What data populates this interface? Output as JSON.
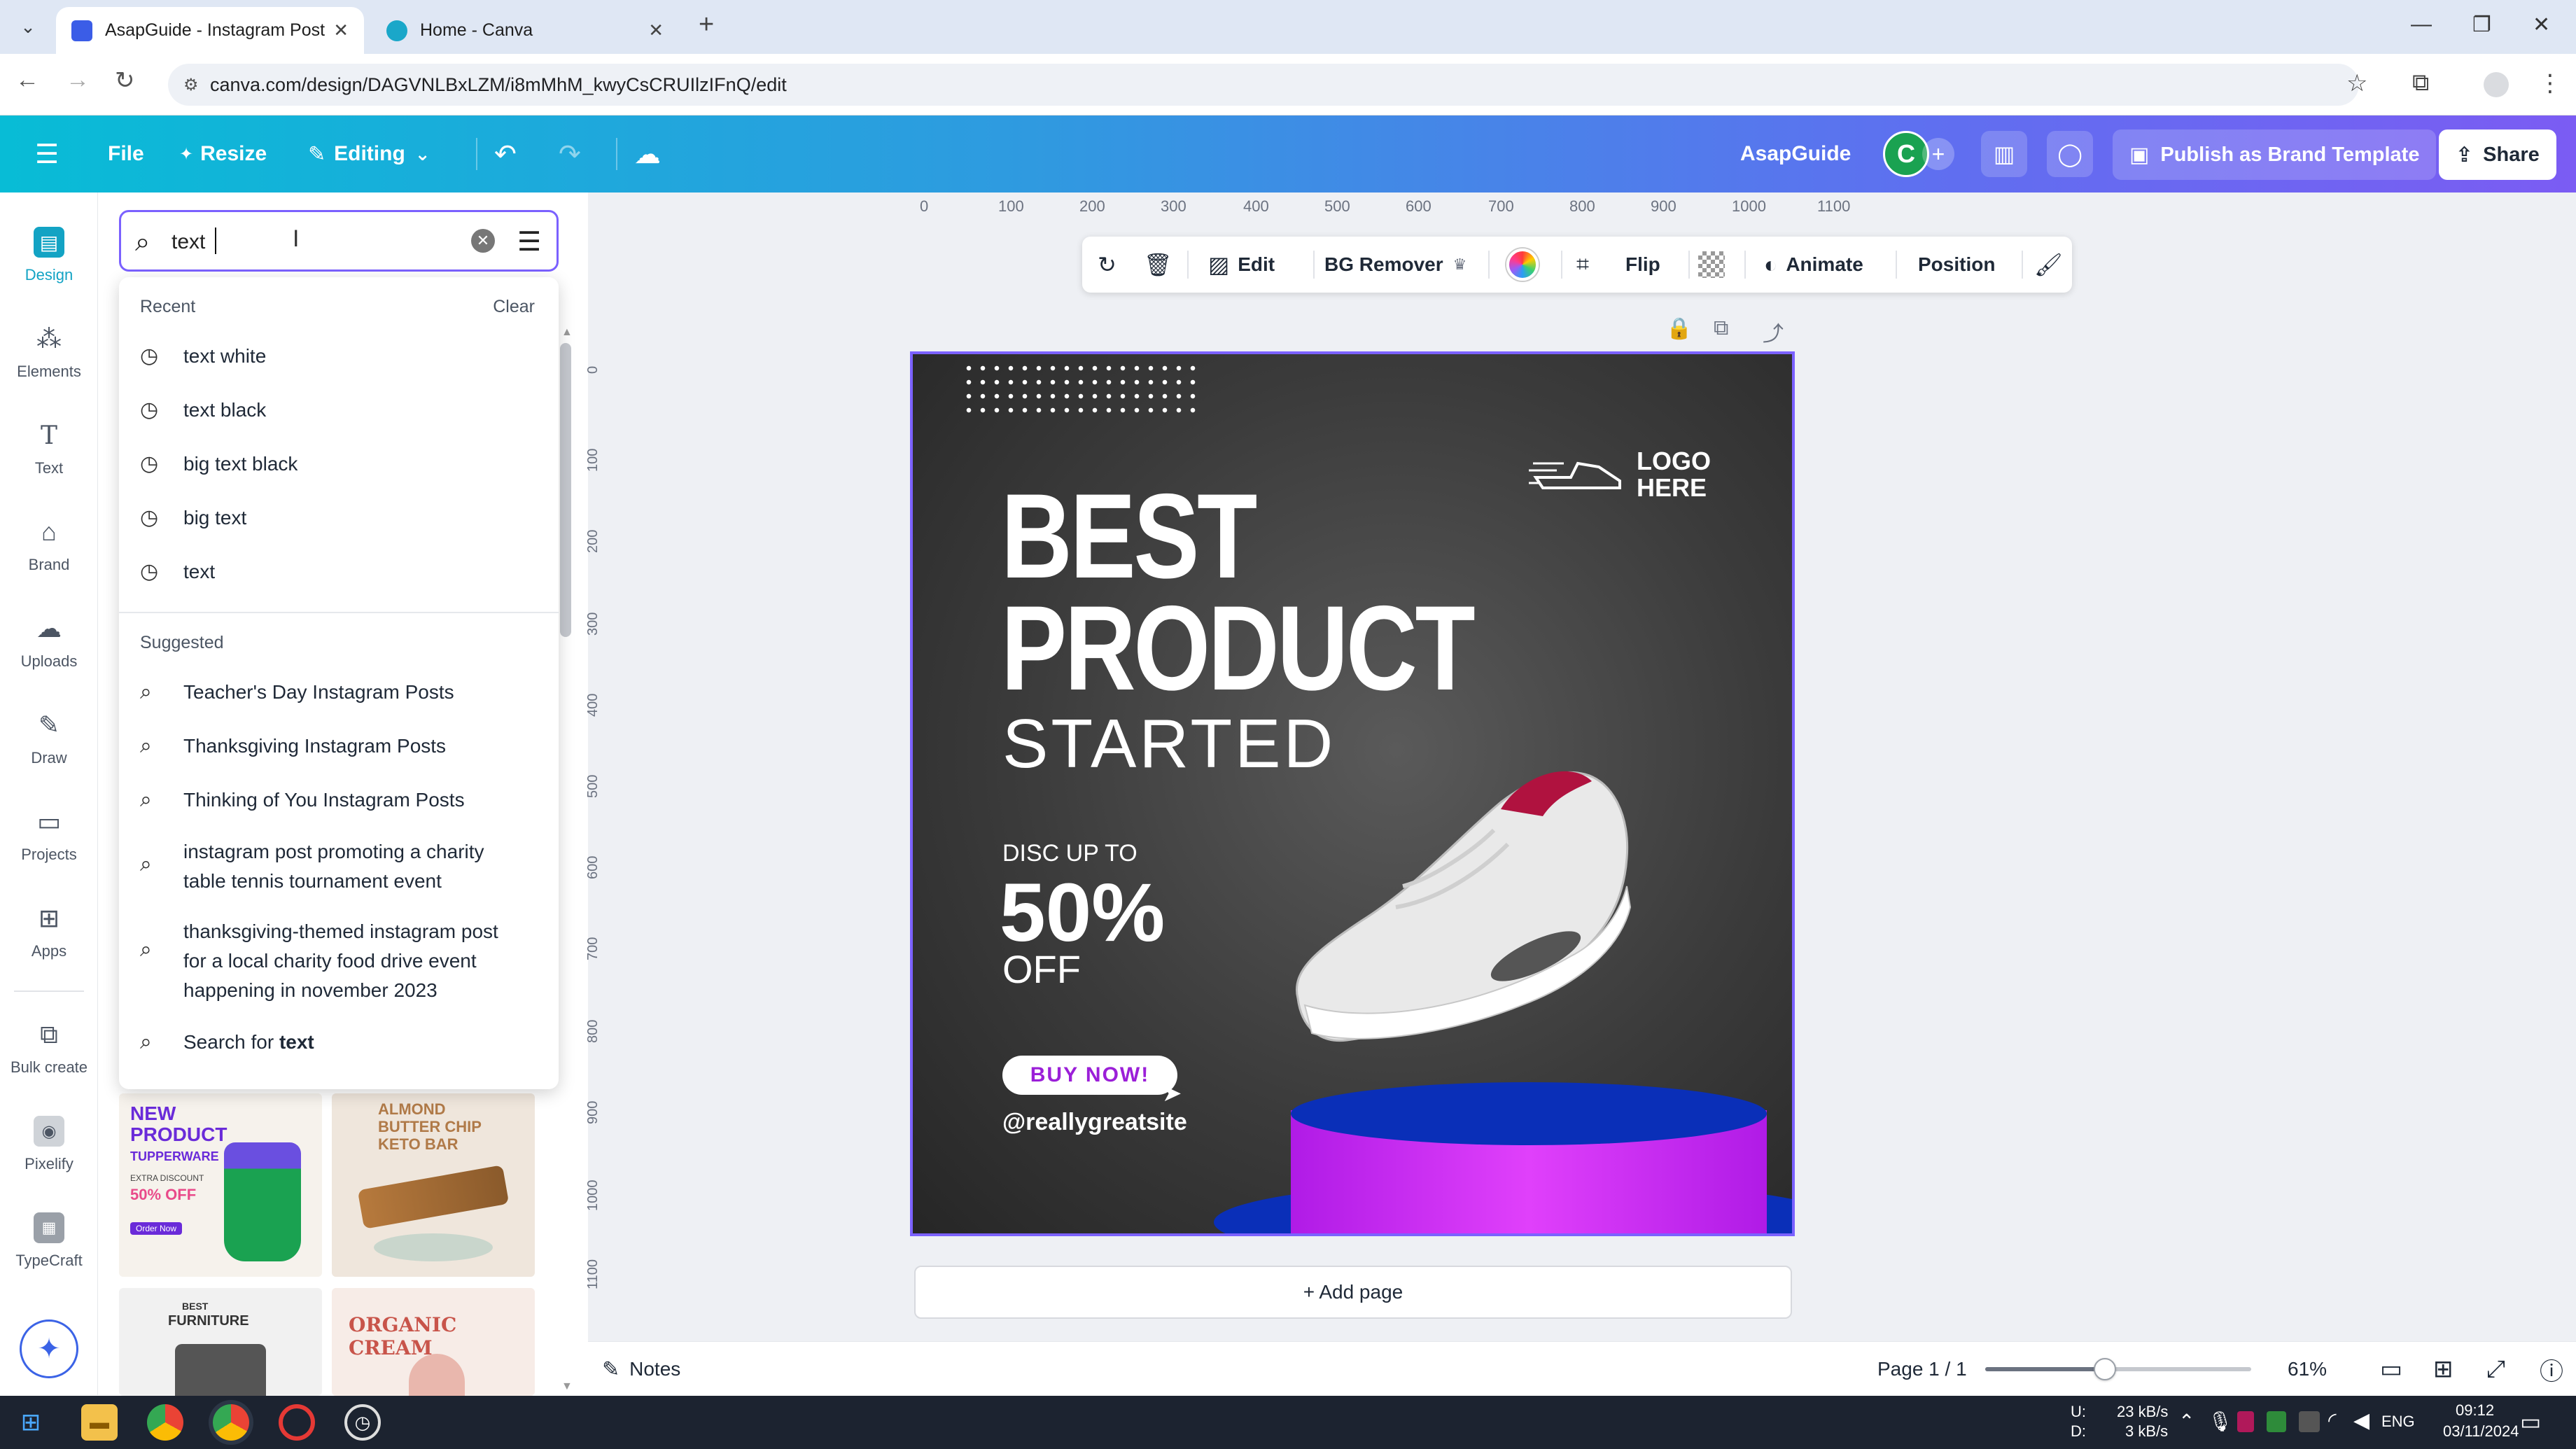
{
  "browser": {
    "tabs": [
      {
        "title": "AsapGuide - Instagram Post",
        "active": true,
        "favicon_color": "#3b5de7"
      },
      {
        "title": "Home - Canva",
        "active": false,
        "favicon_color": "#1aa7c9"
      }
    ],
    "url": "canva.com/design/DAGVNLBxLZM/i8mMhM_kwyCsCRUIlzIFnQ/edit"
  },
  "header": {
    "file": "File",
    "resize": "Resize",
    "editing": "Editing",
    "doc_name": "AsapGuide",
    "avatar_initial": "C",
    "publish": "Publish as Brand Template",
    "share": "Share"
  },
  "rail": {
    "items": [
      {
        "label": "Design",
        "icon": "design-icon"
      },
      {
        "label": "Elements",
        "icon": "elements-icon"
      },
      {
        "label": "Text",
        "icon": "text-icon"
      },
      {
        "label": "Brand",
        "icon": "brand-icon"
      },
      {
        "label": "Uploads",
        "icon": "uploads-icon"
      },
      {
        "label": "Draw",
        "icon": "draw-icon"
      },
      {
        "label": "Projects",
        "icon": "projects-icon"
      },
      {
        "label": "Apps",
        "icon": "apps-icon"
      },
      {
        "label": "Bulk create",
        "icon": "bulk-create-icon"
      },
      {
        "label": "Pixelify",
        "icon": "pixelify-icon"
      },
      {
        "label": "TypeCraft",
        "icon": "typecraft-icon"
      }
    ]
  },
  "search": {
    "value": "text",
    "recent_heading": "Recent",
    "clear": "Clear",
    "recent": [
      "text white",
      "text black",
      "big text black",
      "big text",
      "text"
    ],
    "suggested_heading": "Suggested",
    "suggested": [
      "Teacher's Day Instagram Posts",
      "Thanksgiving Instagram Posts",
      "Thinking of You Instagram Posts",
      "instagram post promoting a charity table tennis tournament event",
      "thanksgiving-themed instagram post for a local charity food drive event happening in november 2023"
    ],
    "search_for_prefix": "Search for ",
    "search_for_term": "text"
  },
  "templates": [
    {
      "line1": "NEW",
      "line2": "PRODUCT",
      "line3": "TUPPERWARE",
      "line4": "EXTRA DISCOUNT",
      "line5": "50% OFF",
      "line6": "Order Now"
    },
    {
      "line1": "ALMOND",
      "line2": "BUTTER CHIP",
      "line3": "KETO BAR"
    },
    {
      "line1": "BEST",
      "line2": "FURNITURE"
    },
    {
      "line1": "ORGANIC CREAM"
    }
  ],
  "ruler": {
    "top": [
      "0",
      "100",
      "200",
      "300",
      "400",
      "500",
      "600",
      "700",
      "800",
      "900",
      "1000",
      "1100"
    ],
    "left": [
      "0",
      "100",
      "200",
      "300",
      "400",
      "500",
      "600",
      "700",
      "800",
      "900",
      "1000",
      "1100"
    ]
  },
  "toolbar": {
    "edit": "Edit",
    "bg_remover": "BG Remover",
    "flip": "Flip",
    "animate": "Animate",
    "position": "Position"
  },
  "design": {
    "headline1": "BEST",
    "headline2": "PRODUCT",
    "headline3": "STARTED",
    "disc": "DISC UP TO",
    "pct": "50%",
    "off": "OFF",
    "buy": "BUY NOW!",
    "site": "@reallygreatsite",
    "logo1": "LOGO",
    "logo2": "HERE",
    "accent_purple": "#9b1fd8",
    "podium_blue": "#0a2fb8"
  },
  "add_page": "+ Add page",
  "status": {
    "notes": "Notes",
    "page": "Page 1 / 1",
    "zoom": "61%",
    "zoom_level": 0.45
  },
  "taskbar": {
    "net_u_label": "U:",
    "net_d_label": "D:",
    "net_up": "23 kB/s",
    "net_down": "3 kB/s",
    "lang": "ENG",
    "time": "09:12",
    "date": "03/11/2024"
  }
}
